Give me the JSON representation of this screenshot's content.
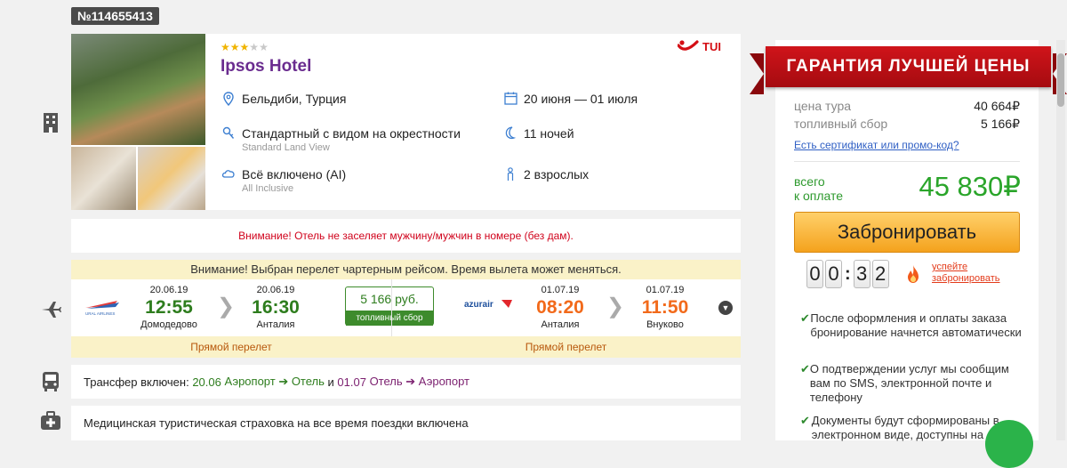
{
  "order": {
    "number": "№114655413"
  },
  "hotel": {
    "stars_filled": 3,
    "stars_total": 5,
    "name": "Ipsos Hotel",
    "operator": "TUI",
    "location": "Бельдиби, Турция",
    "room": "Стандартный с видом на окрестности",
    "room_en": "Standard Land View",
    "meal": "Всё включено (AI)",
    "meal_en": "All Inclusive",
    "dates": "20 июня — 01 июля",
    "nights": "11 ночей",
    "guests": "2 взрослых",
    "icons": {
      "location": "map-pin-icon",
      "room": "key-icon",
      "meal": "cloud-icon",
      "dates": "calendar-icon",
      "nights": "moon-icon",
      "guests": "person-icon"
    }
  },
  "warning_hotel": "Внимание! Отель не заселяет мужчину/мужчин в номере (без дам).",
  "flight": {
    "banner": "Внимание! Выбран перелет чартерным рейсом. Время вылета может меняться.",
    "outbound": {
      "airline_logo": "URAL AIRLINES",
      "dep_date": "20.06.19",
      "dep_time": "12:55",
      "dep_airport": "Домодедово",
      "arr_date": "20.06.19",
      "arr_time": "16:30",
      "arr_airport": "Анталия",
      "type": "Прямой перелет"
    },
    "fuel": {
      "price": "5 166 руб.",
      "label": "топливный сбор"
    },
    "inbound": {
      "airline_logo": "azurair",
      "dep_date": "01.07.19",
      "dep_time": "08:20",
      "dep_airport": "Анталия",
      "arr_date": "01.07.19",
      "arr_time": "11:50",
      "arr_airport": "Внуково",
      "type": "Прямой перелет"
    }
  },
  "transfer": {
    "prefix": "Трансфер включен: ",
    "out_date": "20.06",
    "out_route": " Аэропорт ➔ Отель",
    "sep": " и ",
    "in_date": "01.07",
    "in_route": " Отель ➔ Аэропорт"
  },
  "insurance": "Медицинская туристическая страховка на все время поездки включена",
  "price": {
    "ribbon": "ГАРАНТИЯ ЛУЧШЕЙ ЦЕНЫ",
    "tour_label": "цена тура",
    "tour_value": "40 664₽",
    "fuel_label": "топливный сбор",
    "fuel_value": "5 166₽",
    "promo_link": "Есть сертификат или промо-код?",
    "total_label_1": "всего",
    "total_label_2": "к оплате",
    "total_value": "45 830₽",
    "book_button": "Забронировать",
    "timer_digits": [
      "0",
      "0",
      "3",
      "2"
    ],
    "hurry_1": "успейте",
    "hurry_2": "забронировать",
    "notes": [
      "После оформления и оплаты заказа бронирование начнется автоматически",
      "О подтверждении услуг мы сообщим вам по SMS, электронной почте и телефону",
      "Документы будут сформированы в электронном виде, доступны на"
    ]
  },
  "colors": {
    "brand_purple": "#6a2c8f",
    "green": "#2e7d1e",
    "orange": "#f26a1b",
    "red": "#d0021b",
    "ribbon_red": "#c8121a",
    "button_orange": "#f4a21d"
  }
}
